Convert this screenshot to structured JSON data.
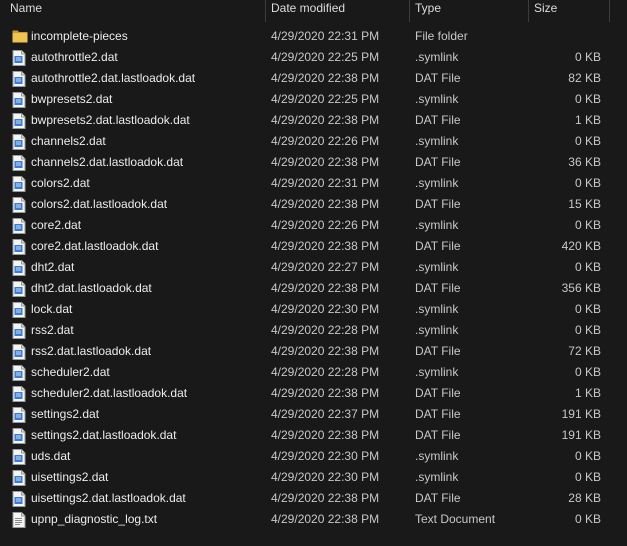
{
  "columns": {
    "name": "Name",
    "date": "Date modified",
    "type": "Type",
    "size": "Size"
  },
  "colors": {
    "background": "#191919",
    "folder": "#e8b94a",
    "dat_icon": "#3b7bd4"
  },
  "files": [
    {
      "name": "incomplete-pieces",
      "date": "4/29/2020 22:31 PM",
      "type": "File folder",
      "size": "",
      "icon": "folder-icon"
    },
    {
      "name": "autothrottle2.dat",
      "date": "4/29/2020 22:25 PM",
      "type": ".symlink",
      "size": "0 KB",
      "icon": "dat-file-icon"
    },
    {
      "name": "autothrottle2.dat.lastloadok.dat",
      "date": "4/29/2020 22:38 PM",
      "type": "DAT File",
      "size": "82 KB",
      "icon": "dat-file-icon"
    },
    {
      "name": "bwpresets2.dat",
      "date": "4/29/2020 22:25 PM",
      "type": ".symlink",
      "size": "0 KB",
      "icon": "dat-file-icon"
    },
    {
      "name": "bwpresets2.dat.lastloadok.dat",
      "date": "4/29/2020 22:38 PM",
      "type": "DAT File",
      "size": "1 KB",
      "icon": "dat-file-icon"
    },
    {
      "name": "channels2.dat",
      "date": "4/29/2020 22:26 PM",
      "type": ".symlink",
      "size": "0 KB",
      "icon": "dat-file-icon"
    },
    {
      "name": "channels2.dat.lastloadok.dat",
      "date": "4/29/2020 22:38 PM",
      "type": "DAT File",
      "size": "36 KB",
      "icon": "dat-file-icon"
    },
    {
      "name": "colors2.dat",
      "date": "4/29/2020 22:31 PM",
      "type": ".symlink",
      "size": "0 KB",
      "icon": "dat-file-icon"
    },
    {
      "name": "colors2.dat.lastloadok.dat",
      "date": "4/29/2020 22:38 PM",
      "type": "DAT File",
      "size": "15 KB",
      "icon": "dat-file-icon"
    },
    {
      "name": "core2.dat",
      "date": "4/29/2020 22:26 PM",
      "type": ".symlink",
      "size": "0 KB",
      "icon": "dat-file-icon"
    },
    {
      "name": "core2.dat.lastloadok.dat",
      "date": "4/29/2020 22:38 PM",
      "type": "DAT File",
      "size": "420 KB",
      "icon": "dat-file-icon"
    },
    {
      "name": "dht2.dat",
      "date": "4/29/2020 22:27 PM",
      "type": ".symlink",
      "size": "0 KB",
      "icon": "dat-file-icon"
    },
    {
      "name": "dht2.dat.lastloadok.dat",
      "date": "4/29/2020 22:38 PM",
      "type": "DAT File",
      "size": "356 KB",
      "icon": "dat-file-icon"
    },
    {
      "name": "lock.dat",
      "date": "4/29/2020 22:30 PM",
      "type": ".symlink",
      "size": "0 KB",
      "icon": "dat-file-icon"
    },
    {
      "name": "rss2.dat",
      "date": "4/29/2020 22:28 PM",
      "type": ".symlink",
      "size": "0 KB",
      "icon": "dat-file-icon"
    },
    {
      "name": "rss2.dat.lastloadok.dat",
      "date": "4/29/2020 22:38 PM",
      "type": "DAT File",
      "size": "72 KB",
      "icon": "dat-file-icon"
    },
    {
      "name": "scheduler2.dat",
      "date": "4/29/2020 22:28 PM",
      "type": ".symlink",
      "size": "0 KB",
      "icon": "dat-file-icon"
    },
    {
      "name": "scheduler2.dat.lastloadok.dat",
      "date": "4/29/2020 22:38 PM",
      "type": "DAT File",
      "size": "1 KB",
      "icon": "dat-file-icon"
    },
    {
      "name": "settings2.dat",
      "date": "4/29/2020 22:37 PM",
      "type": "DAT File",
      "size": "191 KB",
      "icon": "dat-file-icon"
    },
    {
      "name": "settings2.dat.lastloadok.dat",
      "date": "4/29/2020 22:38 PM",
      "type": "DAT File",
      "size": "191 KB",
      "icon": "dat-file-icon"
    },
    {
      "name": "uds.dat",
      "date": "4/29/2020 22:30 PM",
      "type": ".symlink",
      "size": "0 KB",
      "icon": "dat-file-icon"
    },
    {
      "name": "uisettings2.dat",
      "date": "4/29/2020 22:30 PM",
      "type": ".symlink",
      "size": "0 KB",
      "icon": "dat-file-icon"
    },
    {
      "name": "uisettings2.dat.lastloadok.dat",
      "date": "4/29/2020 22:38 PM",
      "type": "DAT File",
      "size": "28 KB",
      "icon": "dat-file-icon"
    },
    {
      "name": "upnp_diagnostic_log.txt",
      "date": "4/29/2020 22:38 PM",
      "type": "Text Document",
      "size": "0 KB",
      "icon": "text-file-icon"
    }
  ]
}
